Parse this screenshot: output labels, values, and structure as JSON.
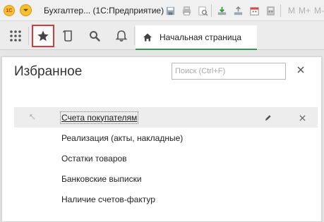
{
  "window": {
    "logo_text": "1С",
    "title": "Бухгалтер... (1С:Предприятие)",
    "toolbar_text": [
      "M",
      "M+",
      "M-"
    ]
  },
  "navbar": {
    "home_tab_label": "Начальная страница"
  },
  "favorites": {
    "title": "Избранное",
    "search_placeholder": "Поиск (Ctrl+F)",
    "items": [
      {
        "label": "Счета покупателям",
        "selected": true
      },
      {
        "label": "Реализация (акты, накладные)",
        "selected": false
      },
      {
        "label": "Остатки товаров",
        "selected": false
      },
      {
        "label": "Банковские выписки",
        "selected": false
      },
      {
        "label": "Наличие счетов-фактур",
        "selected": false
      }
    ]
  },
  "colors": {
    "accent_green": "#2f9a48",
    "highlight_red": "#d23b3b",
    "logo_yellow": "#f6c12e"
  }
}
